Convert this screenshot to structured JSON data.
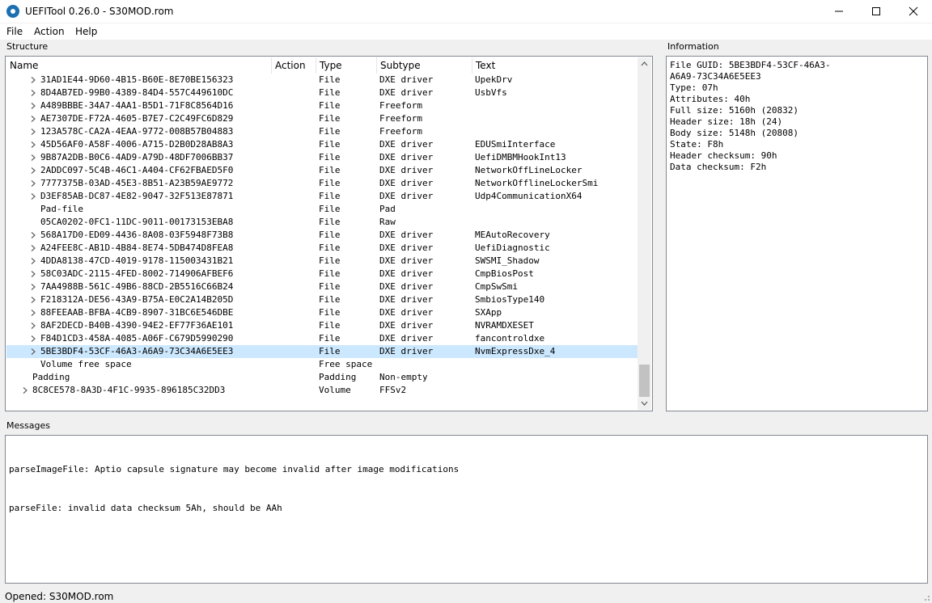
{
  "window": {
    "title": "UEFITool 0.26.0 - S30MOD.rom",
    "icon": "uefitool-app-icon"
  },
  "menu": {
    "items": [
      "File",
      "Action",
      "Help"
    ]
  },
  "structure": {
    "label": "Structure",
    "columns": [
      "Name",
      "Action",
      "Type",
      "Subtype",
      "Text"
    ],
    "rows": [
      {
        "name": "31AD1E44-9D60-4B15-B60E-8E70BE156323",
        "action": "",
        "type": "File",
        "subtype": "DXE driver",
        "text": "UpekDrv",
        "expandable": true,
        "indent": 1
      },
      {
        "name": "8D4AB7ED-99B0-4389-84D4-557C449610DC",
        "action": "",
        "type": "File",
        "subtype": "DXE driver",
        "text": "UsbVfs",
        "expandable": true,
        "indent": 1
      },
      {
        "name": "A489BBBE-34A7-4AA1-B5D1-71F8C8564D16",
        "action": "",
        "type": "File",
        "subtype": "Freeform",
        "text": "",
        "expandable": true,
        "indent": 1
      },
      {
        "name": "AE7307DE-F72A-4605-B7E7-C2C49FC6D829",
        "action": "",
        "type": "File",
        "subtype": "Freeform",
        "text": "",
        "expandable": true,
        "indent": 1
      },
      {
        "name": "123A578C-CA2A-4EAA-9772-008B57B04883",
        "action": "",
        "type": "File",
        "subtype": "Freeform",
        "text": "",
        "expandable": true,
        "indent": 1
      },
      {
        "name": "45D56AF0-A58F-4006-A715-D2B0D28AB8A3",
        "action": "",
        "type": "File",
        "subtype": "DXE driver",
        "text": "EDUSmiInterface",
        "expandable": true,
        "indent": 1
      },
      {
        "name": "9B87A2DB-B0C6-4AD9-A79D-48DF7006BB37",
        "action": "",
        "type": "File",
        "subtype": "DXE driver",
        "text": "UefiDMBMHookInt13",
        "expandable": true,
        "indent": 1
      },
      {
        "name": "2ADDC097-5C4B-46C1-A404-CF62FBAED5F0",
        "action": "",
        "type": "File",
        "subtype": "DXE driver",
        "text": "NetworkOffLineLocker",
        "expandable": true,
        "indent": 1
      },
      {
        "name": "7777375B-03AD-45E3-8B51-A23B59AE9772",
        "action": "",
        "type": "File",
        "subtype": "DXE driver",
        "text": "NetworkOfflineLockerSmi",
        "expandable": true,
        "indent": 1
      },
      {
        "name": "D3EF85AB-DC87-4E82-9047-32F513E87871",
        "action": "",
        "type": "File",
        "subtype": "DXE driver",
        "text": "Udp4CommunicationX64",
        "expandable": true,
        "indent": 1
      },
      {
        "name": "Pad-file",
        "action": "",
        "type": "File",
        "subtype": "Pad",
        "text": "",
        "expandable": false,
        "indent": 1
      },
      {
        "name": "05CA0202-0FC1-11DC-9011-00173153EBA8",
        "action": "",
        "type": "File",
        "subtype": "Raw",
        "text": "",
        "expandable": false,
        "indent": 1
      },
      {
        "name": "568A17D0-ED09-4436-8A08-03F5948F73B8",
        "action": "",
        "type": "File",
        "subtype": "DXE driver",
        "text": "MEAutoRecovery",
        "expandable": true,
        "indent": 1
      },
      {
        "name": "A24FEE8C-AB1D-4B84-8E74-5DB474D8FEA8",
        "action": "",
        "type": "File",
        "subtype": "DXE driver",
        "text": "UefiDiagnostic",
        "expandable": true,
        "indent": 1
      },
      {
        "name": "4DDA8138-47CD-4019-9178-115003431B21",
        "action": "",
        "type": "File",
        "subtype": "DXE driver",
        "text": "SWSMI_Shadow",
        "expandable": true,
        "indent": 1
      },
      {
        "name": "58C03ADC-2115-4FED-8002-714906AFBEF6",
        "action": "",
        "type": "File",
        "subtype": "DXE driver",
        "text": "CmpBiosPost",
        "expandable": true,
        "indent": 1
      },
      {
        "name": "7AA4988B-561C-49B6-88CD-2B5516C66B24",
        "action": "",
        "type": "File",
        "subtype": "DXE driver",
        "text": "CmpSwSmi",
        "expandable": true,
        "indent": 1
      },
      {
        "name": "F218312A-DE56-43A9-B75A-E0C2A14B205D",
        "action": "",
        "type": "File",
        "subtype": "DXE driver",
        "text": "SmbiosType140",
        "expandable": true,
        "indent": 1
      },
      {
        "name": "88FEEAAB-BFBA-4CB9-8907-31BC6E546DBE",
        "action": "",
        "type": "File",
        "subtype": "DXE driver",
        "text": "SXApp",
        "expandable": true,
        "indent": 1
      },
      {
        "name": "8AF2DECD-B40B-4390-94E2-EF77F36AE101",
        "action": "",
        "type": "File",
        "subtype": "DXE driver",
        "text": "NVRAMDXESET",
        "expandable": true,
        "indent": 1
      },
      {
        "name": "F84D1CD3-458A-4085-A06F-C679D5990290",
        "action": "",
        "type": "File",
        "subtype": "DXE driver",
        "text": "fancontroldxe",
        "expandable": true,
        "indent": 1
      },
      {
        "name": "5BE3BDF4-53CF-46A3-A6A9-73C34A6E5EE3",
        "action": "",
        "type": "File",
        "subtype": "DXE driver",
        "text": "NvmExpressDxe_4",
        "expandable": true,
        "indent": 1,
        "selected": true
      },
      {
        "name": "Volume free space",
        "action": "",
        "type": "Free space",
        "subtype": "",
        "text": "",
        "expandable": false,
        "indent": 1
      },
      {
        "name": "Padding",
        "action": "",
        "type": "Padding",
        "subtype": "Non-empty",
        "text": "",
        "expandable": false,
        "indent": 0
      },
      {
        "name": "8C8CE578-8A3D-4F1C-9935-896185C32DD3",
        "action": "",
        "type": "Volume",
        "subtype": "FFSv2",
        "text": "",
        "expandable": true,
        "indent": 0
      }
    ]
  },
  "information": {
    "label": "Information",
    "text": "File GUID: 5BE3BDF4-53CF-46A3-\nA6A9-73C34A6E5EE3\nType: 07h\nAttributes: 40h\nFull size: 5160h (20832)\nHeader size: 18h (24)\nBody size: 5148h (20808)\nState: F8h\nHeader checksum: 90h\nData checksum: F2h"
  },
  "messages": {
    "label": "Messages",
    "lines": [
      "parseImageFile: Aptio capsule signature may become invalid after image modifications",
      "parseFile: invalid data checksum 5Ah, should be AAh"
    ]
  },
  "status": {
    "text": "Opened: S30MOD.rom"
  },
  "colors": {
    "selection": "#cce8ff",
    "panel_border": "#828790",
    "window_bg": "#f0f0f0"
  }
}
